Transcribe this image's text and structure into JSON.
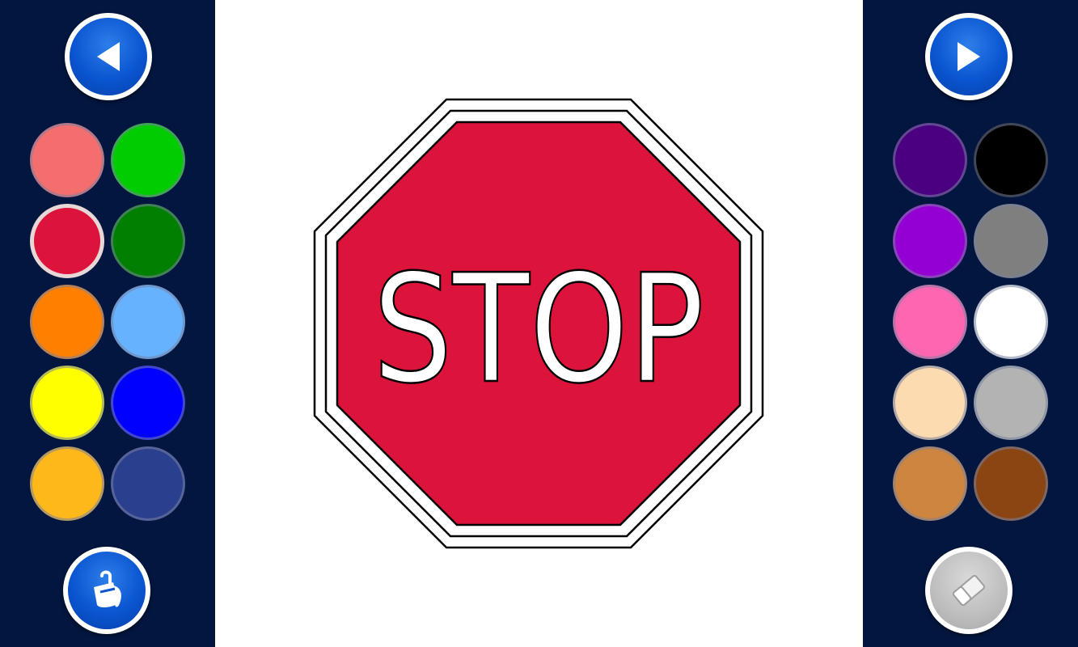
{
  "nav": {
    "prev_icon": "arrow-left-icon",
    "next_icon": "arrow-right-icon"
  },
  "tools": {
    "fill_icon": "paint-bucket-icon",
    "eraser_icon": "eraser-icon",
    "eraser_enabled": false
  },
  "palette": {
    "left": [
      "#f56e6e",
      "#00cc00",
      "#dc143c",
      "#007f00",
      "#ff8000",
      "#66b2ff",
      "#ffff00",
      "#0000ff",
      "#ffb819",
      "#2b3f8f"
    ],
    "right": [
      "#4b0082",
      "#000000",
      "#9400d3",
      "#7f7f7f",
      "#ff66b2",
      "#ffffff",
      "#fddbb0",
      "#b3b3b3",
      "#cd853f",
      "#8b4513"
    ],
    "selected_index_left": 2
  },
  "picture": {
    "sign_text": "STOP",
    "fill_color": "#dc143c",
    "text_color": "#ffffff"
  }
}
